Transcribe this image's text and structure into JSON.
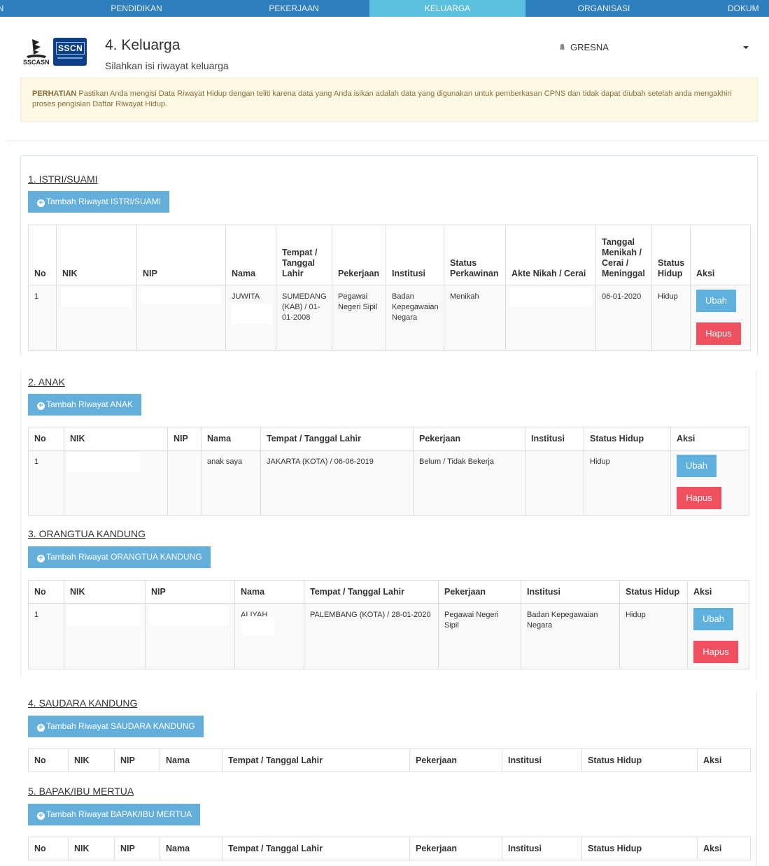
{
  "nav": {
    "tabs": [
      "N",
      "PENDIDIKAN",
      "PEKERJAAN",
      "KELUARGA",
      "ORGANISASI",
      "DOKUM"
    ],
    "active": "KELUARGA"
  },
  "header": {
    "logo_text": "SSCN",
    "logo_caption": "SSCASN",
    "title": "4. Keluarga",
    "subtitle": "Silahkan isi riwayat keluarga",
    "user_name": "GRESNA"
  },
  "alert": {
    "label": "PERHATIAN",
    "text": " Pastikan Anda mengisi Data Riwayat Hidup dengan teliti karena data yang Anda isikan adalah data yang digunakan untuk pemberkasan CPNS dan tidak dapat diubah setelah anda mengakhiri proses pengisian Daftar Riwayat Hidup."
  },
  "sections": {
    "s1": {
      "title": "1. ISTRI/SUAMI",
      "add_label": "Tambah Riwayat ISTRI/SUAMI",
      "headers": [
        "No",
        "NIK",
        "NIP",
        "Nama",
        "Tempat / Tanggal Lahir",
        "Pekerjaan",
        "Institusi",
        "Status Perkawinan",
        "Akte Nikah / Cerai",
        "Tanggal Menikah / Cerai / Meninggal",
        "Status Hidup",
        "Aksi"
      ],
      "row": {
        "no": "1",
        "nik": "",
        "nip": "",
        "nama": "JUWITA",
        "ttl": "SUMEDANG (KAB) / 01-01-2008",
        "pekerjaan": "Pegawai Negeri Sipil",
        "institusi": "Badan Kepegawaian Negara",
        "status_perkawinan": "Menikah",
        "akte": "",
        "tanggal": "06-01-2020",
        "status_hidup": "Hidup"
      }
    },
    "s2": {
      "title": "2. ANAK",
      "add_label": "Tambah Riwayat ANAK",
      "headers": [
        "No",
        "NIK",
        "NIP",
        "Nama",
        "Tempat / Tanggal Lahir",
        "Pekerjaan",
        "Institusi",
        "Status Hidup",
        "Aksi"
      ],
      "row": {
        "no": "1",
        "nik": "",
        "nip": "",
        "nama": "anak saya",
        "ttl": "JAKARTA (KOTA) / 06-06-2019",
        "pekerjaan": "Belum / Tidak Bekerja",
        "institusi": "",
        "status_hidup": "Hidup"
      }
    },
    "s3": {
      "title": "3. ORANGTUA KANDUNG",
      "add_label": "Tambah Riwayat ORANGTUA KANDUNG",
      "headers": [
        "No",
        "NIK",
        "NIP",
        "Nama",
        "Tempat / Tanggal Lahir",
        "Pekerjaan",
        "Institusi",
        "Status Hidup",
        "Aksi"
      ],
      "row": {
        "no": "1",
        "nik": "",
        "nip": "",
        "nama": "ALIYAH",
        "ttl": "PALEMBANG (KOTA) / 28-01-2020",
        "pekerjaan": "Pegawai Negeri Sipil",
        "institusi": "Badan Kepegawaian Negara",
        "status_hidup": "Hidup"
      }
    },
    "s4": {
      "title": "4. SAUDARA KANDUNG",
      "add_label": "Tambah Riwayat SAUDARA KANDUNG",
      "headers": [
        "No",
        "NIK",
        "NIP",
        "Nama",
        "Tempat / Tanggal Lahir",
        "Pekerjaan",
        "Institusi",
        "Status Hidup",
        "Aksi"
      ]
    },
    "s5": {
      "title": "5. BAPAK/IBU MERTUA",
      "add_label": "Tambah Riwayat BAPAK/IBU MERTUA",
      "headers": [
        "No",
        "NIK",
        "NIP",
        "Nama",
        "Tempat / Tanggal Lahir",
        "Pekerjaan",
        "Institusi",
        "Status Hidup",
        "Aksi"
      ]
    }
  },
  "actions": {
    "edit": "Ubah",
    "delete": "Hapus"
  },
  "colors": {
    "nav": "#2f7fbf",
    "nav_active": "#5bc0de",
    "primary_button": "#63aedb",
    "danger_button": "#f0505f",
    "alert_bg": "#fcf8e3"
  },
  "icons": {
    "add": "plus-circle-icon",
    "user": "bell-icon",
    "menu": "caret-down-icon"
  }
}
